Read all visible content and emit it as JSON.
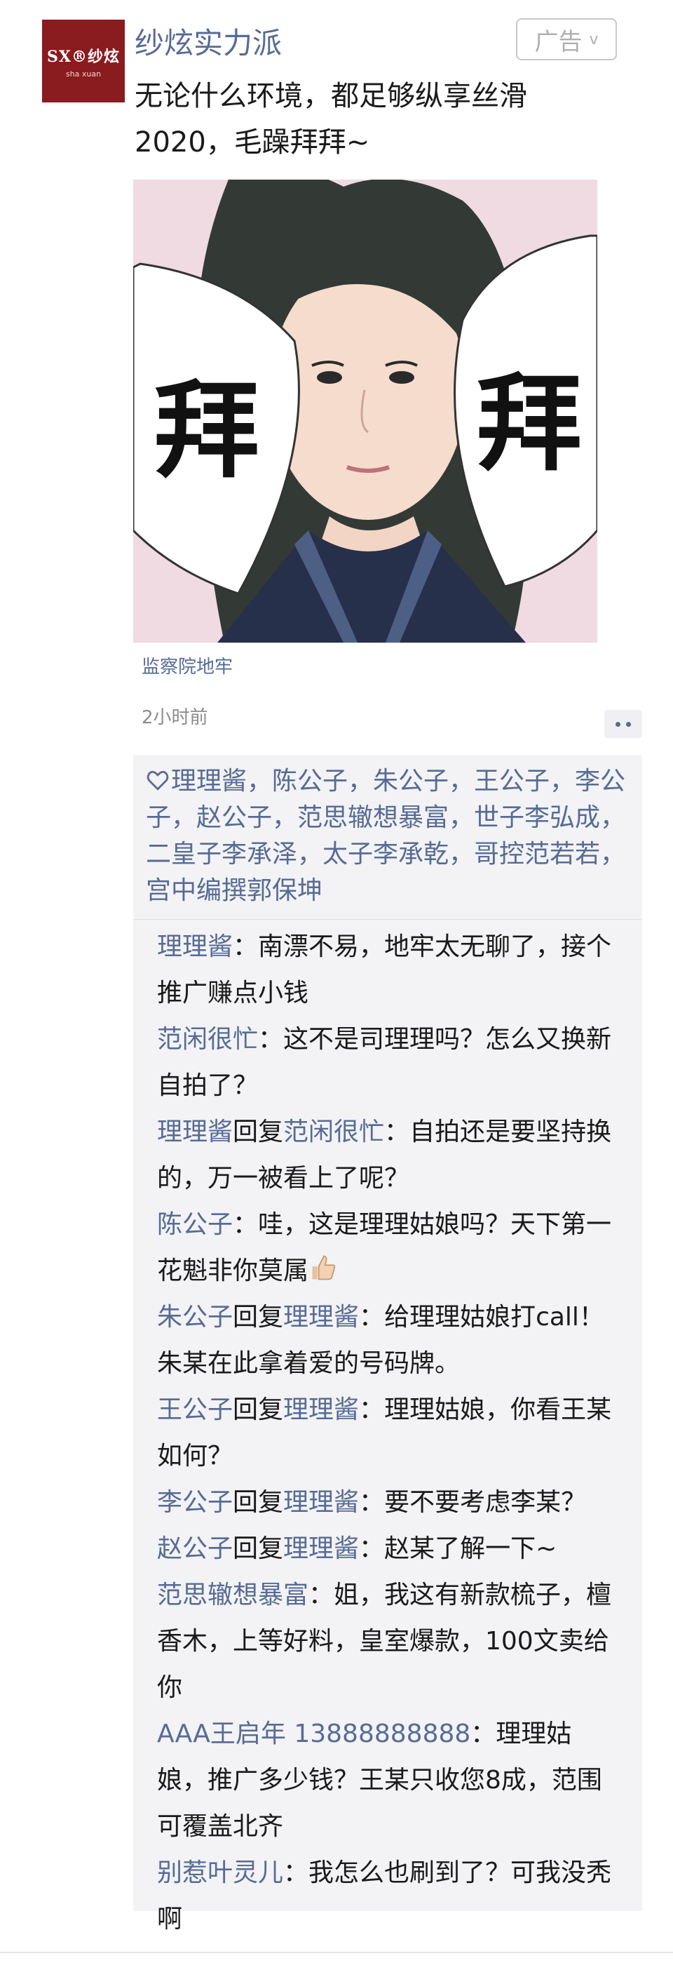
{
  "post": {
    "avatar_text": "SX®纱炫",
    "avatar_sub": "sha xuan",
    "author": "纱炫实力派",
    "ad_label": "广告",
    "text": "无论什么环境，都足够纵享丝滑2020，毛躁拜拜~",
    "image_char_left": "拜",
    "image_char_right": "拜",
    "location": "监察院地牢",
    "time": "2小时前"
  },
  "likes": "理理酱，陈公子，朱公子，王公子，李公子，赵公子，范思辙想暴富，世子李弘成，二皇子李承泽，太子李承乾，哥控范若若，宫中编撰郭保坤",
  "comments": [
    {
      "name": "理理酱",
      "reply_word": "",
      "reply_to": "",
      "sep": "：",
      "text": "南漂不易，地牢太无聊了，接个推广赚点小钱"
    },
    {
      "name": "范闲很忙",
      "reply_word": "",
      "reply_to": "",
      "sep": "：",
      "text": "这不是司理理吗？怎么又换新自拍了？"
    },
    {
      "name": "理理酱",
      "reply_word": "回复",
      "reply_to": "范闲很忙",
      "sep": "：",
      "text": "自拍还是要坚持换的，万一被看上了呢？"
    },
    {
      "name": "陈公子",
      "reply_word": "",
      "reply_to": "",
      "sep": "：",
      "text": "哇，这是理理姑娘吗？天下第一花魁非你莫属"
    },
    {
      "name": "朱公子",
      "reply_word": "回复",
      "reply_to": "理理酱",
      "sep": "：",
      "text": "给理理姑娘打call！朱某在此拿着爱的号码牌。"
    },
    {
      "name": "王公子",
      "reply_word": "回复",
      "reply_to": "理理酱",
      "sep": "：",
      "text": "理理姑娘，你看王某如何？"
    },
    {
      "name": "李公子",
      "reply_word": "回复",
      "reply_to": "理理酱",
      "sep": "：",
      "text": "要不要考虑李某？"
    },
    {
      "name": "赵公子",
      "reply_word": "回复",
      "reply_to": "理理酱",
      "sep": "：",
      "text": "赵某了解一下~"
    },
    {
      "name": "范思辙想暴富",
      "reply_word": "",
      "reply_to": "",
      "sep": "：",
      "text": "姐，我这有新款梳子，檀香木，上等好料，皇室爆款，100文卖给你"
    },
    {
      "name": "AAA王启年 13888888888",
      "reply_word": "",
      "reply_to": "",
      "sep": "：",
      "text": "理理姑娘，推广多少钱？王某只收您8成，范围可覆盖北齐"
    },
    {
      "name": "别惹叶灵儿",
      "reply_word": "",
      "reply_to": "",
      "sep": "：",
      "text": "我怎么也刷到了？可我没秃啊"
    }
  ],
  "colors": {
    "name_link": "#576b95",
    "panel_bg": "#f3f3f5",
    "avatar_bg": "#8a1b1f"
  }
}
